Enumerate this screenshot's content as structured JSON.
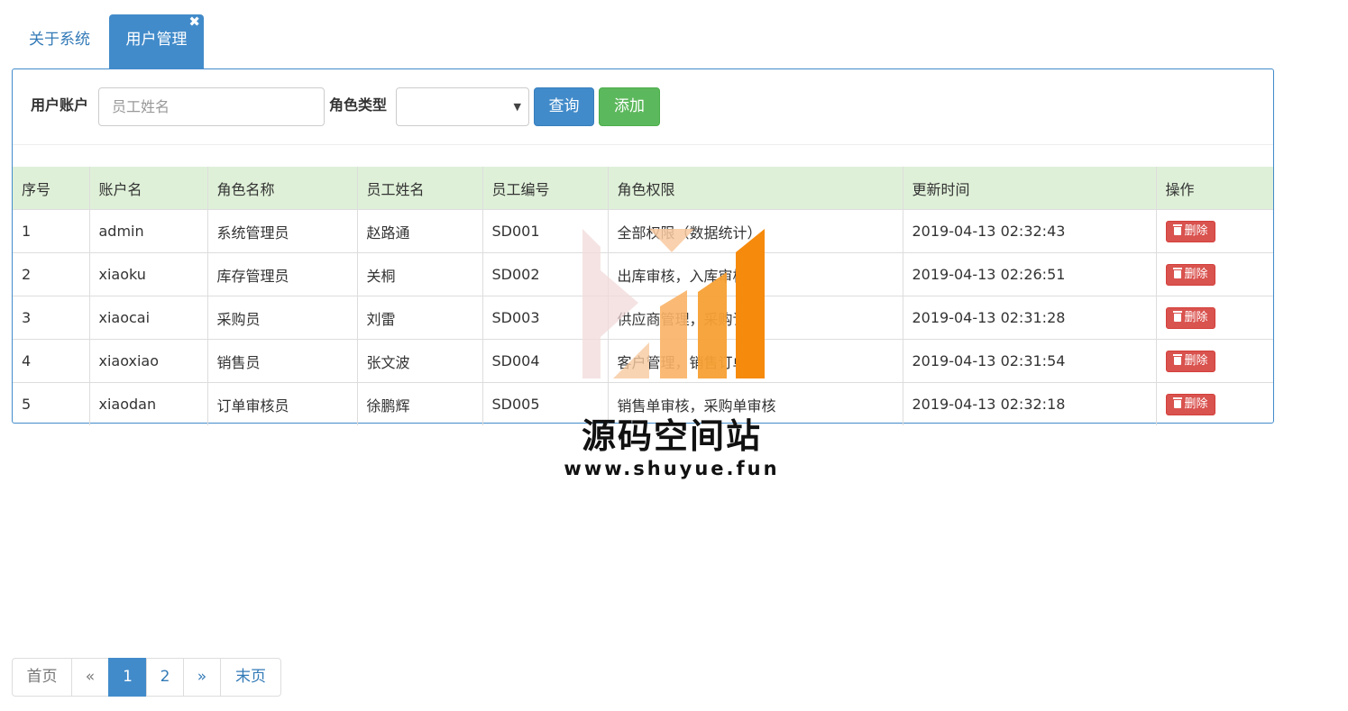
{
  "tabs": {
    "items": [
      {
        "label": "关于系统",
        "active": false
      },
      {
        "label": "用户管理",
        "active": true
      }
    ],
    "close_icon": "✖"
  },
  "search": {
    "account_label": "用户账户",
    "name_placeholder": "员工姓名",
    "name_value": "",
    "role_label": "角色类型",
    "role_selected": "",
    "query_button": "查询",
    "add_button": "添加"
  },
  "table": {
    "headers": [
      "序号",
      "账户名",
      "角色名称",
      "员工姓名",
      "员工编号",
      "角色权限",
      "更新时间",
      "操作"
    ],
    "rows": [
      [
        "1",
        "admin",
        "系统管理员",
        "赵路通",
        "SD001",
        "全部权限（数据统计）",
        "2019-04-13 02:32:43",
        "删除"
      ],
      [
        "2",
        "xiaoku",
        "库存管理员",
        "关桐",
        "SD002",
        "出库审核，入库审核",
        "2019-04-13 02:26:51",
        "删除"
      ],
      [
        "3",
        "xiaocai",
        "采购员",
        "刘雷",
        "SD003",
        "供应商管理，采购订单",
        "2019-04-13 02:31:28",
        "删除"
      ],
      [
        "4",
        "xiaoxiao",
        "销售员",
        "张文波",
        "SD004",
        "客户管理，销售订单",
        "2019-04-13 02:31:54",
        "删除"
      ],
      [
        "5",
        "xiaodan",
        "订单审核员",
        "徐鹏辉",
        "SD005",
        "销售单审核，采购单审核",
        "2019-04-13 02:32:18",
        "删除"
      ]
    ]
  },
  "watermark": {
    "title": "源码空间站",
    "url": "www.shuyue.fun"
  },
  "pagination": {
    "first": "首页",
    "prev": "«",
    "pages": [
      "1",
      "2"
    ],
    "current": "1",
    "next": "»",
    "last": "末页"
  },
  "colors": {
    "primary": "#428bca",
    "success": "#5cb85c",
    "danger": "#d9534f",
    "table_header_bg": "#dff0d8",
    "link": "#337ab7"
  }
}
